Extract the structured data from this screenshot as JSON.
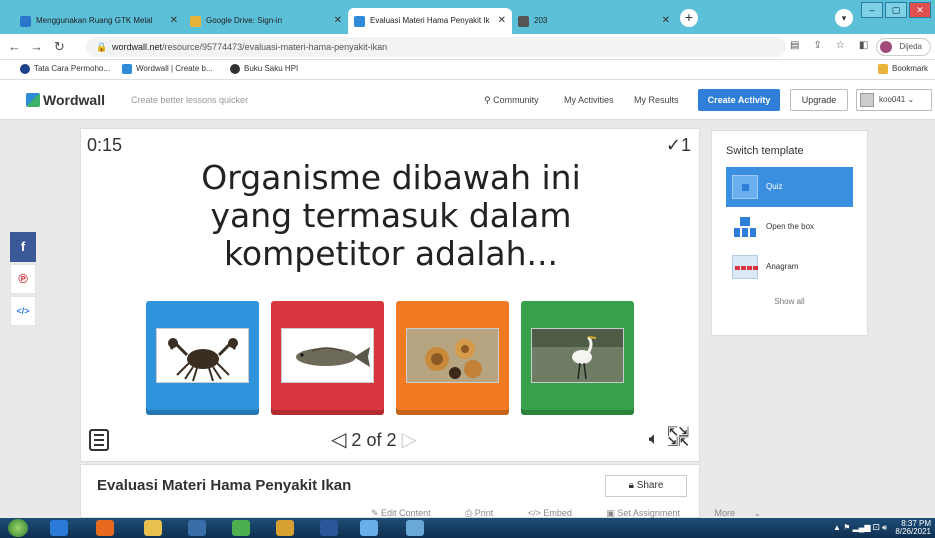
{
  "browser": {
    "tabs": [
      {
        "label": "Menggunakan Ruang GTK Melal",
        "color": "#2a77c9"
      },
      {
        "label": "Google Drive: Sign-in",
        "color": "#e8b53a"
      },
      {
        "label": "Evaluasi Materi Hama Penyakit Ik",
        "color": "#2d8bd8"
      },
      {
        "label": "203",
        "color": "#555555"
      }
    ],
    "url_domain": "wordwall.net",
    "url_path": "/resource/95774473/evaluasi-materi-hama-penyakit-ikan",
    "profile_label": "Dijeda",
    "bookmarks": [
      "Tata Cara Permoho...",
      "Wordwall | Create b...",
      "Buku Saku HPI"
    ],
    "bookmarks_other": "Bookmark"
  },
  "header": {
    "logo": "Wordwall",
    "tagline": "Create better lessons quicker",
    "nav": [
      "Community",
      "My Activities",
      "My Results"
    ],
    "create_label": "Create Activity",
    "upgrade_label": "Upgrade",
    "user_label": "koo041"
  },
  "game": {
    "timer": "0:15",
    "score": "✓1",
    "question_lines": [
      "Organisme dibawah ini",
      "yang termasuk dalam",
      "kompetitor adalah..."
    ],
    "answers": [
      {
        "image": "crab",
        "color": "#2e93db"
      },
      {
        "image": "fish",
        "color": "#d9353f"
      },
      {
        "image": "snails",
        "color": "#f27b22"
      },
      {
        "image": "egret",
        "color": "#36a04a"
      }
    ],
    "page_current": "2",
    "page_of": "of",
    "page_total": "2"
  },
  "switch_template": {
    "title": "Switch template",
    "items": [
      "Quiz",
      "Open the box",
      "Anagram"
    ],
    "show_all": "Show all"
  },
  "activity": {
    "title": "Evaluasi Materi Hama Penyakit Ikan",
    "share_label": "Share",
    "links": [
      "Edit Content",
      "Print",
      "Embed",
      "Set Assignment",
      "More"
    ]
  },
  "taskbar": {
    "time": "8:37 PM",
    "date": "8/26/2021"
  }
}
